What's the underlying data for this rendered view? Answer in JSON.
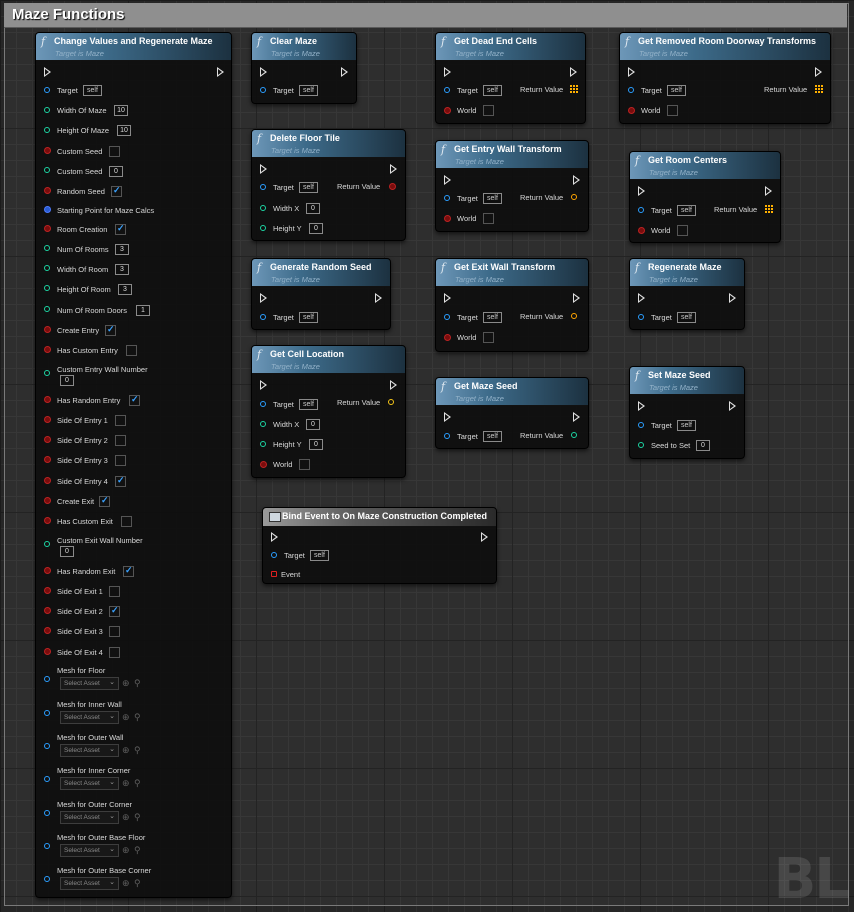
{
  "comment": {
    "title": "Maze Functions"
  },
  "common": {
    "subtitle": "Target is Maze",
    "self": "self",
    "return_value": "Return Value",
    "target": "Target",
    "world": "World",
    "zero": "0"
  },
  "colors": {
    "exec": "#e0e0e0",
    "object_pin": "#2a9eff",
    "int_pin": "#1dd5a3",
    "bool_pin": "#7a0d0d",
    "transform_pin": "#ffa500",
    "header_accent": "#3d6b8a"
  },
  "nodes": {
    "change_values": {
      "title": "Change Values and Regenerate Maze",
      "pins": {
        "target": "Target",
        "width_of_maze": {
          "label": "Width Of Maze",
          "value": "10"
        },
        "height_of_maze": {
          "label": "Height Of Maze",
          "value": "10"
        },
        "custom_seed_bool": {
          "label": "Custom Seed"
        },
        "custom_seed_int": {
          "label": "Custom Seed",
          "value": "0"
        },
        "random_seed": {
          "label": "Random Seed",
          "checked": true
        },
        "starting_point": {
          "label": "Starting Point for Maze Calcs"
        },
        "room_creation": {
          "label": "Room Creation",
          "checked": true
        },
        "num_of_rooms": {
          "label": "Num Of Rooms",
          "value": "3"
        },
        "width_of_room": {
          "label": "Width Of Room",
          "value": "3"
        },
        "height_of_room": {
          "label": "Height Of Room",
          "value": "3"
        },
        "num_of_room_doors": {
          "label": "Num Of Room Doors",
          "value": "1"
        },
        "create_entry": {
          "label": "Create Entry",
          "checked": true
        },
        "has_custom_entry": {
          "label": "Has Custom Entry",
          "checked": false
        },
        "custom_entry_wall_number": {
          "label": "Custom Entry Wall Number",
          "value": "0"
        },
        "has_random_entry": {
          "label": "Has Random Entry",
          "checked": true
        },
        "side_of_entry_1": {
          "label": "Side Of Entry 1",
          "checked": false
        },
        "side_of_entry_2": {
          "label": "Side Of Entry 2",
          "checked": false
        },
        "side_of_entry_3": {
          "label": "Side Of Entry 3",
          "checked": false
        },
        "side_of_entry_4": {
          "label": "Side Of Entry 4",
          "checked": true
        },
        "create_exit": {
          "label": "Create Exit",
          "checked": true
        },
        "has_custom_exit": {
          "label": "Has Custom Exit",
          "checked": false
        },
        "custom_exit_wall_number": {
          "label": "Custom Exit Wall Number",
          "value": "0"
        },
        "has_random_exit": {
          "label": "Has Random Exit",
          "checked": true
        },
        "side_of_exit_1": {
          "label": "Side Of Exit 1",
          "checked": false
        },
        "side_of_exit_2": {
          "label": "Side Of Exit 2",
          "checked": true
        },
        "side_of_exit_3": {
          "label": "Side Of Exit 3",
          "checked": false
        },
        "side_of_exit_4": {
          "label": "Side Of Exit 4",
          "checked": false
        }
      },
      "meshes": [
        {
          "label": "Mesh for Floor",
          "select": "Select Asset"
        },
        {
          "label": "Mesh for Inner Wall",
          "select": "Select Asset"
        },
        {
          "label": "Mesh for Outer Wall",
          "select": "Select Asset"
        },
        {
          "label": "Mesh for Inner Corner",
          "select": "Select Asset"
        },
        {
          "label": "Mesh for Outer Corner",
          "select": "Select Asset"
        },
        {
          "label": "Mesh for Outer Base Floor",
          "select": "Select Asset"
        },
        {
          "label": "Mesh for Outer Base Corner",
          "select": "Select Asset"
        }
      ]
    },
    "clear_maze": {
      "title": "Clear Maze"
    },
    "delete_floor_tile": {
      "title": "Delete Floor Tile",
      "width_x": "Width X",
      "height_y": "Height Y"
    },
    "generate_random_seed": {
      "title": "Generate Random Seed"
    },
    "get_cell_location": {
      "title": "Get Cell Location",
      "width_x": "Width X",
      "height_y": "Height Y"
    },
    "get_dead_end_cells": {
      "title": "Get Dead End Cells"
    },
    "get_entry_wall_transform": {
      "title": "Get Entry Wall Transform"
    },
    "get_exit_wall_transform": {
      "title": "Get Exit Wall Transform"
    },
    "get_maze_seed": {
      "title": "Get Maze Seed"
    },
    "get_removed_room_doorway_transforms": {
      "title": "Get Removed Room Doorway Transforms"
    },
    "get_room_centers": {
      "title": "Get Room Centers"
    },
    "regenerate_maze": {
      "title": "Regenerate Maze"
    },
    "set_maze_seed": {
      "title": "Set Maze Seed",
      "seed_to_set": "Seed to Set"
    },
    "bind_event": {
      "title": "Bind Event to On Maze Construction Completed",
      "event": "Event"
    }
  },
  "watermark": "BL"
}
